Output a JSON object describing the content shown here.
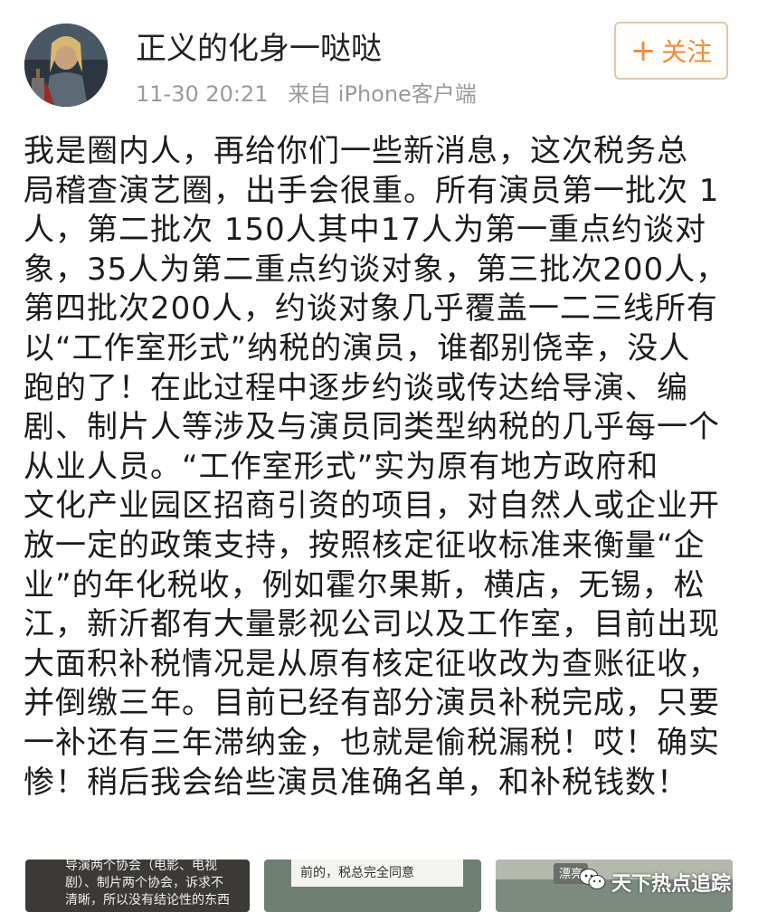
{
  "header": {
    "username": "正义的化身一哒哒",
    "time": "11-30 20:21",
    "source": "来自 iPhone客户端",
    "follow_plus": "+",
    "follow_label": "关注"
  },
  "post": {
    "lines": [
      "我是圈内人，再给你们一些新消息，这次税务总",
      "局稽查演艺圈，出手会很重。所有演员第一批次 1",
      "人，第二批次 150人其中17人为第一重点约谈对",
      "象，35人为第二重点约谈对象，第三批次200人，",
      "第四批次200人，约谈对象几乎覆盖一二三线所有",
      "以“工作室形式”纳税的演员，谁都别侥幸，没人",
      "跑的了！在此过程中逐步约谈或传达给导演、编",
      "剧、制片人等涉及与演员同类型纳税的几乎每一个",
      "从业人员。“工作室形式”实为原有地方政府和",
      "文化产业园区招商引资的项目，对自然人或企业开",
      "放一定的政策支持，按照核定征收标准来衡量“企",
      "业”的年化税收，例如霍尔果斯，横店，无锡，松",
      "江，新沂都有大量影视公司以及工作室，目前出现",
      "大面积补税情况是从原有核定征收改为查账征收，",
      "并倒缴三年。目前已经有部分演员补税完成，只要",
      "一补还有三年滞纳金，也就是偷税漏税！哎！确实",
      "惨！稍后我会给些演员准确名单，和补税钱数！"
    ]
  },
  "thumbnails": [
    {
      "lines": [
        "导演两个协会（电影、电视",
        "剧）、制片两个协会，诉求不",
        "清晰，所以没有结论性的东西"
      ]
    },
    {
      "lines": [
        "前的，税总完全同意"
      ]
    },
    {
      "lines": []
    },
    {
      "lines": [
        "漂亮"
      ]
    }
  ],
  "watermark": {
    "text": "天下热点追踪",
    "icon": "wechat-icon"
  },
  "colors": {
    "follow_text": "#ef8b3a",
    "follow_border": "#e0c8a8",
    "meta_text": "#9a9a9a"
  }
}
